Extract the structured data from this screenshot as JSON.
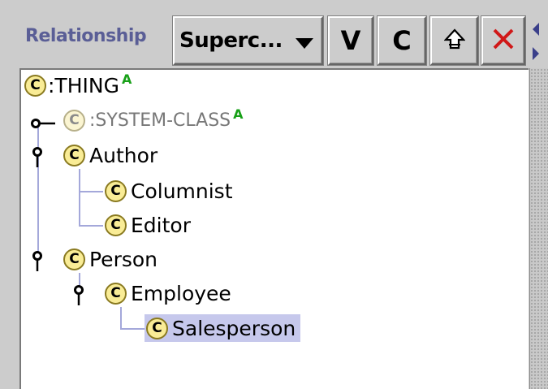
{
  "header": {
    "label": "Relationship",
    "dropdown_value": "Superc...",
    "buttons": {
      "v_label": "V",
      "c_label": "C"
    }
  },
  "tree": {
    "nodes": [
      {
        "label": ":THING",
        "badge": "A"
      },
      {
        "label": ":SYSTEM-CLASS",
        "badge": "A"
      },
      {
        "label": "Author"
      },
      {
        "label": "Columnist"
      },
      {
        "label": "Editor"
      },
      {
        "label": "Person"
      },
      {
        "label": "Employee"
      },
      {
        "label": "Salesperson",
        "selected": true
      }
    ],
    "class_icon_letter": "C"
  },
  "colors": {
    "header_label": "#5a5e96",
    "class_icon_fill": "#f9ec96",
    "selection": "#c6c8ec",
    "badge": "#18a018",
    "tree_lines": "#a4a8da",
    "delete_x": "#d01818"
  },
  "icons": {
    "dropdown": "triangle-down-icon",
    "add_parent": "arrow-up-outline-icon",
    "delete": "red-x-icon",
    "scroll_left": "triangle-left-icon",
    "scroll_right": "triangle-right-icon",
    "expand": "tree-handle-icon"
  }
}
